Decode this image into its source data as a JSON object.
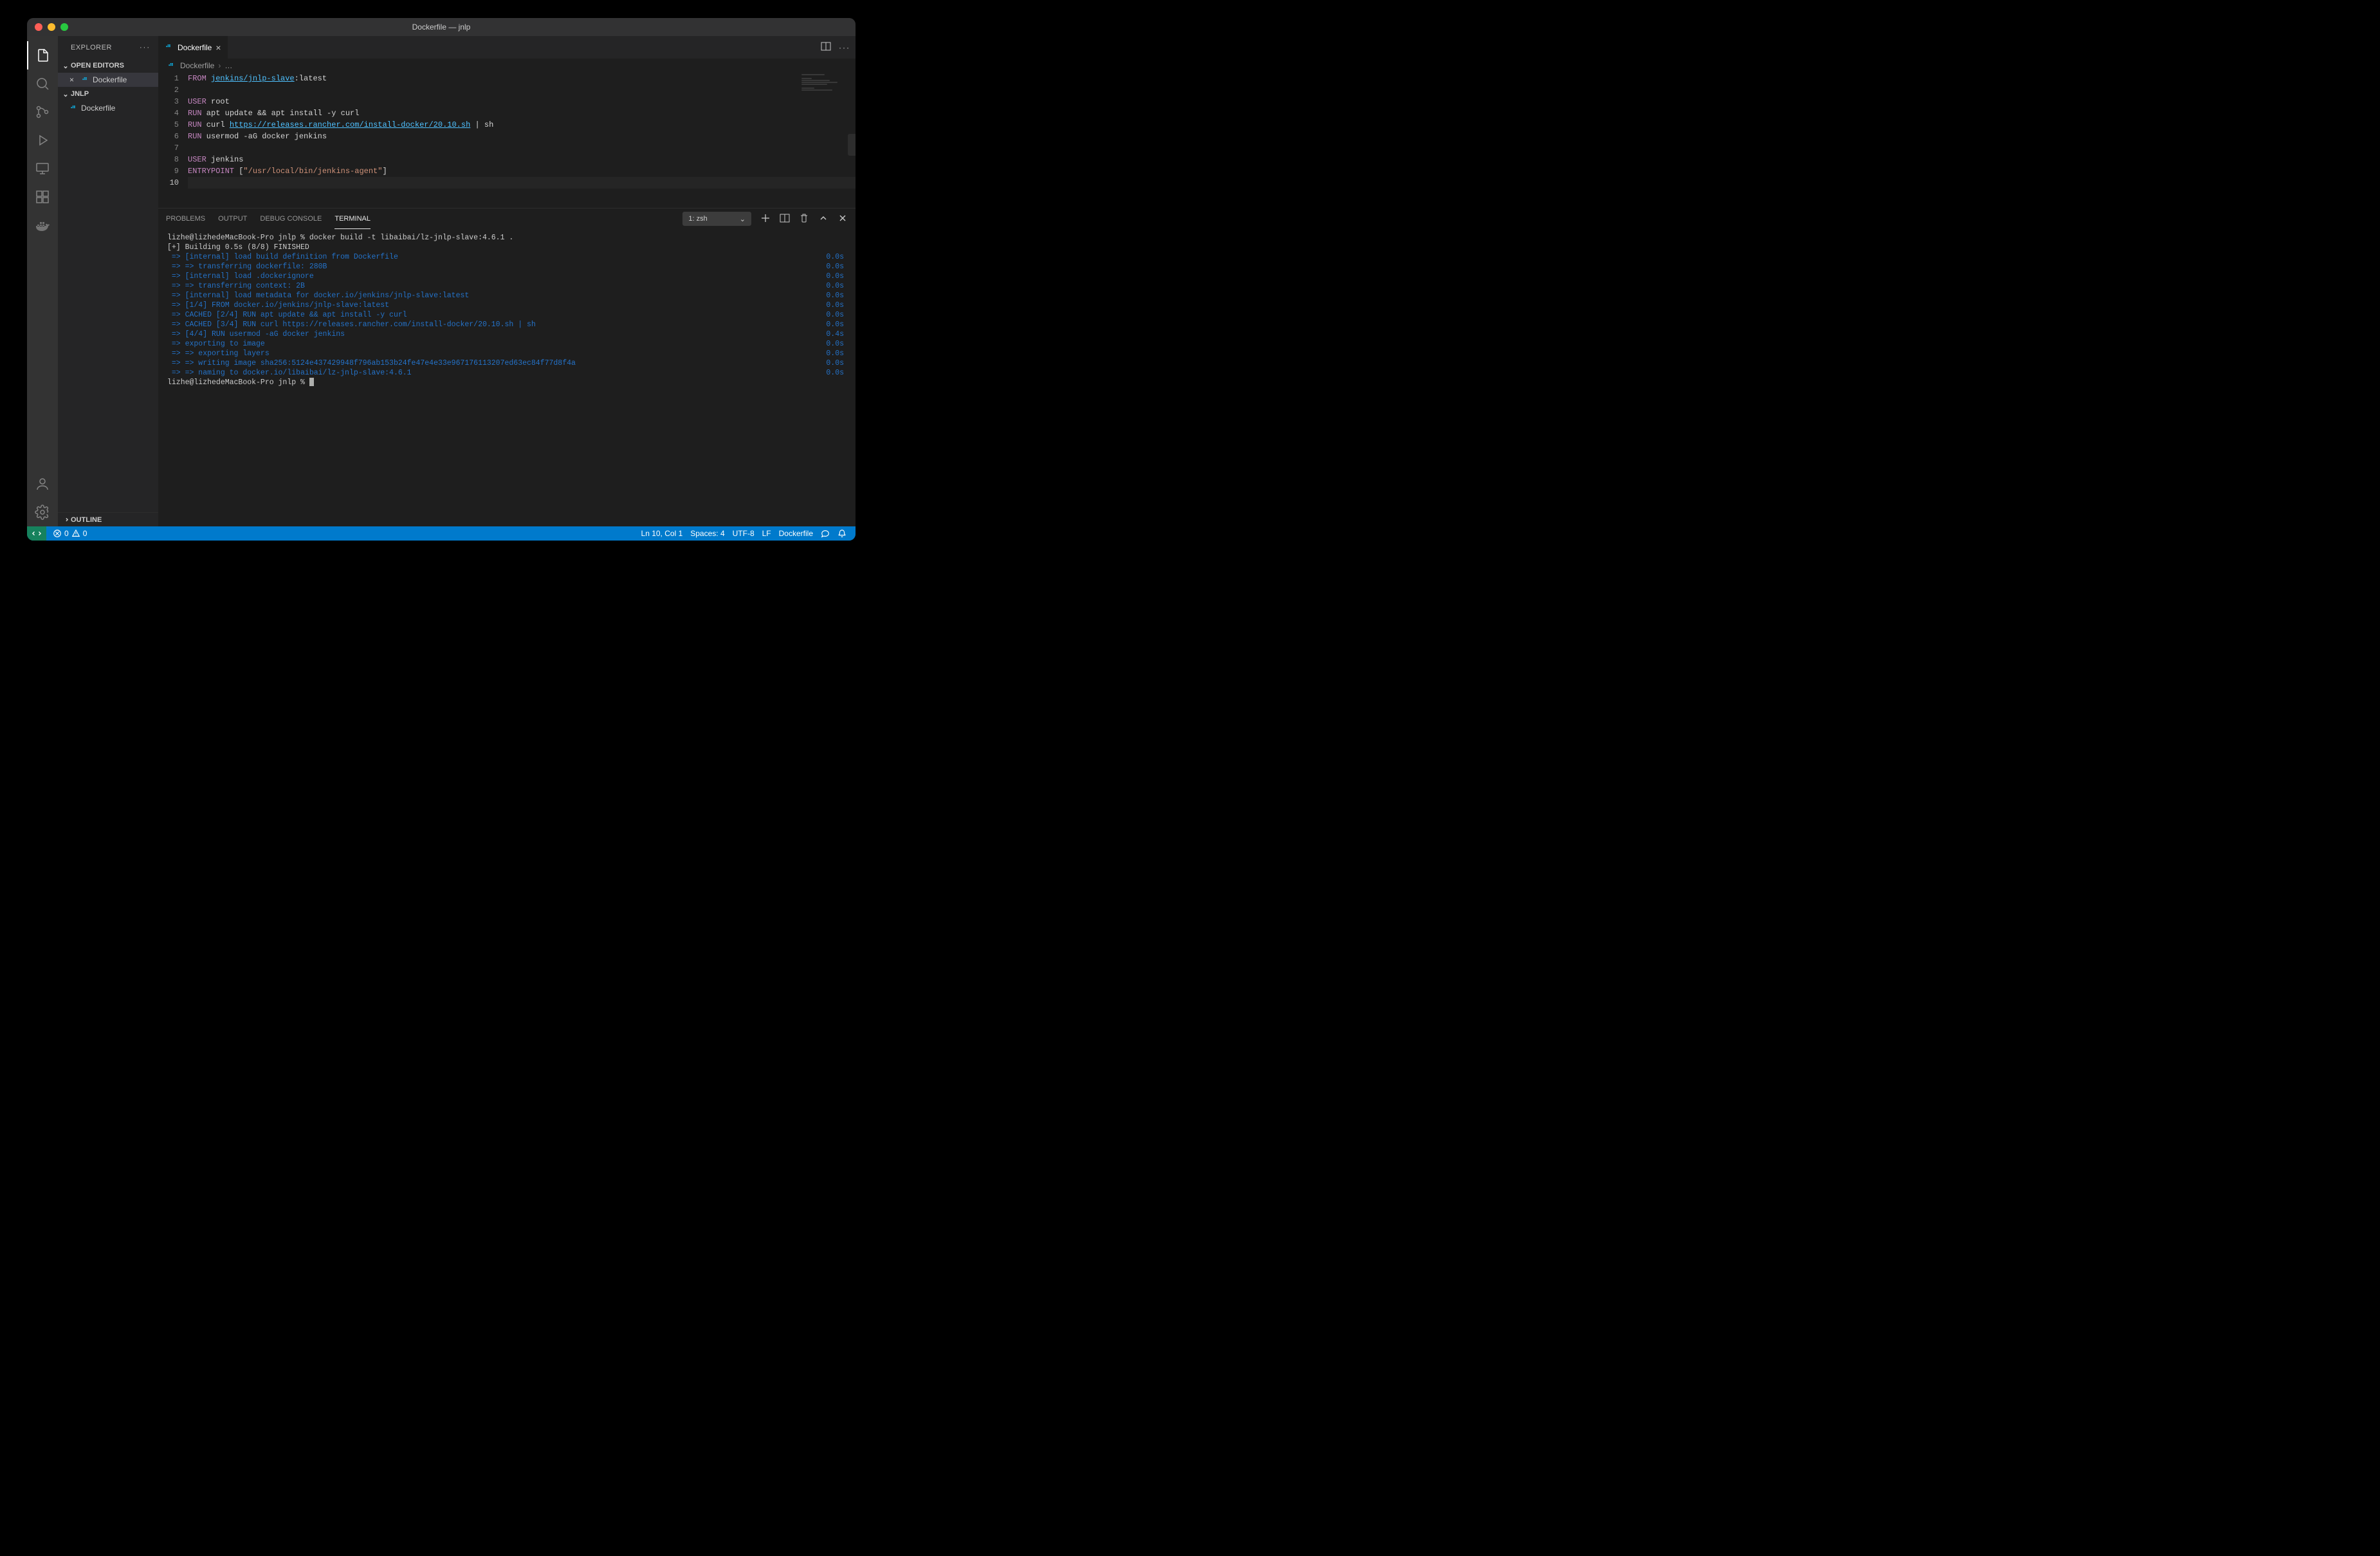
{
  "window": {
    "title": "Dockerfile — jnlp"
  },
  "sidebar": {
    "title": "EXPLORER",
    "sections": {
      "openEditors": "OPEN EDITORS",
      "project": "JNLP",
      "outline": "OUTLINE"
    },
    "openEditorItem": "Dockerfile",
    "projectItem": "Dockerfile"
  },
  "tab": {
    "label": "Dockerfile"
  },
  "breadcrumb": {
    "file": "Dockerfile",
    "more": "…"
  },
  "editor": {
    "lines": [
      {
        "n": "1",
        "segs": [
          {
            "t": "FROM",
            "c": "kw"
          },
          {
            "t": " ",
            "c": "plain"
          },
          {
            "t": "jenkins/jnlp-slave",
            "c": "link"
          },
          {
            "t": ":latest",
            "c": "plain"
          }
        ]
      },
      {
        "n": "2",
        "segs": []
      },
      {
        "n": "3",
        "segs": [
          {
            "t": "USER",
            "c": "kw"
          },
          {
            "t": " root",
            "c": "plain"
          }
        ]
      },
      {
        "n": "4",
        "segs": [
          {
            "t": "RUN",
            "c": "kw"
          },
          {
            "t": " apt update && apt install -y curl",
            "c": "plain"
          }
        ]
      },
      {
        "n": "5",
        "segs": [
          {
            "t": "RUN",
            "c": "kw"
          },
          {
            "t": " curl ",
            "c": "plain"
          },
          {
            "t": "https://releases.rancher.com/install-docker/20.10.sh",
            "c": "link"
          },
          {
            "t": " | sh",
            "c": "plain"
          }
        ]
      },
      {
        "n": "6",
        "segs": [
          {
            "t": "RUN",
            "c": "kw"
          },
          {
            "t": " usermod -aG docker jenkins",
            "c": "plain"
          }
        ]
      },
      {
        "n": "7",
        "segs": []
      },
      {
        "n": "8",
        "segs": [
          {
            "t": "USER",
            "c": "kw"
          },
          {
            "t": " jenkins",
            "c": "plain"
          }
        ]
      },
      {
        "n": "9",
        "segs": [
          {
            "t": "ENTRYPOINT",
            "c": "kw"
          },
          {
            "t": " [",
            "c": "plain"
          },
          {
            "t": "\"/usr/local/bin/jenkins-agent\"",
            "c": "str"
          },
          {
            "t": "]",
            "c": "plain"
          }
        ]
      },
      {
        "n": "10",
        "segs": [],
        "active": true
      }
    ]
  },
  "panel": {
    "tabs": [
      "PROBLEMS",
      "OUTPUT",
      "DEBUG CONSOLE",
      "TERMINAL"
    ],
    "active": "TERMINAL",
    "terminalSelector": "1: zsh"
  },
  "terminal": {
    "prompt1": "lizhe@lizhedeMacBook-Pro jnlp % docker build -t libaibai/lz-jnlp-slave:4.6.1 .",
    "header2": "[+] Building 0.5s (8/8) FINISHED",
    "lines": [
      {
        "txt": " => [internal] load build definition from Dockerfile",
        "time": "0.0s"
      },
      {
        "txt": " => => transferring dockerfile: 280B",
        "time": "0.0s"
      },
      {
        "txt": " => [internal] load .dockerignore",
        "time": "0.0s"
      },
      {
        "txt": " => => transferring context: 2B",
        "time": "0.0s"
      },
      {
        "txt": " => [internal] load metadata for docker.io/jenkins/jnlp-slave:latest",
        "time": "0.0s"
      },
      {
        "txt": " => [1/4] FROM docker.io/jenkins/jnlp-slave:latest",
        "time": "0.0s"
      },
      {
        "txt": " => CACHED [2/4] RUN apt update && apt install -y curl",
        "time": "0.0s"
      },
      {
        "txt": " => CACHED [3/4] RUN curl https://releases.rancher.com/install-docker/20.10.sh | sh",
        "time": "0.0s"
      },
      {
        "txt": " => [4/4] RUN usermod -aG docker jenkins",
        "time": "0.4s"
      },
      {
        "txt": " => exporting to image",
        "time": "0.0s"
      },
      {
        "txt": " => => exporting layers",
        "time": "0.0s"
      },
      {
        "txt": " => => writing image sha256:5124e437429948f796ab153b24fe47e4e33e967176113207ed63ec84f77d8f4a",
        "time": "0.0s"
      },
      {
        "txt": " => => naming to docker.io/libaibai/lz-jnlp-slave:4.6.1",
        "time": "0.0s"
      }
    ],
    "prompt2": "lizhe@lizhedeMacBook-Pro jnlp % "
  },
  "statusbar": {
    "errors": "0",
    "warnings": "0",
    "lncol": "Ln 10, Col 1",
    "spaces": "Spaces: 4",
    "encoding": "UTF-8",
    "eol": "LF",
    "lang": "Dockerfile"
  }
}
